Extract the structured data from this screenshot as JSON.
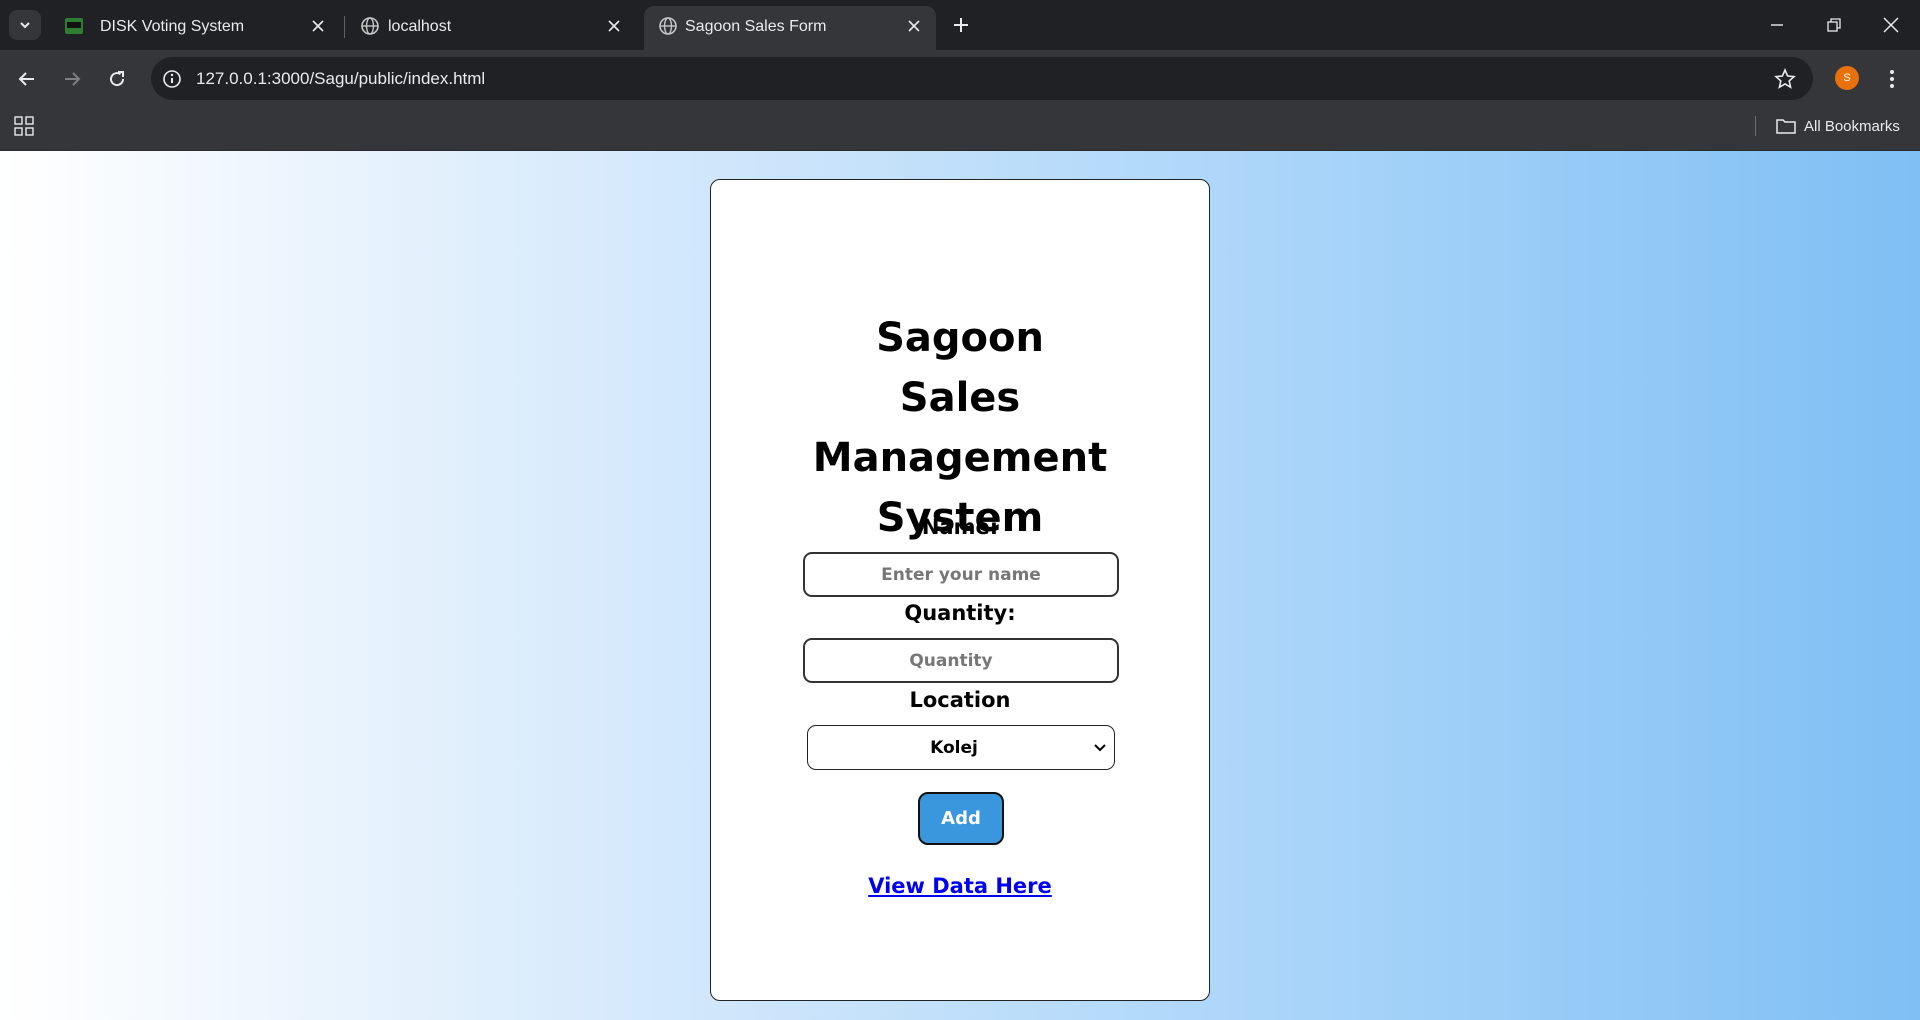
{
  "browser": {
    "tabs": [
      {
        "label": "DISK Voting System",
        "active": false
      },
      {
        "label": "localhost",
        "active": false
      },
      {
        "label": "Sagoon Sales Form",
        "active": true
      }
    ],
    "url": "127.0.0.1:3000/Sagu/public/index.html",
    "profile_initial": "S",
    "bookmarks_label": "All Bookmarks"
  },
  "form": {
    "title": "Sagoon Sales Management System",
    "name_label": "Name:",
    "name_placeholder": "Enter your name",
    "name_value": "",
    "quantity_label": "Quantity:",
    "quantity_placeholder": "Quantity",
    "quantity_value": "",
    "location_label": "Location",
    "location_selected": "Kolej",
    "add_label": "Add",
    "view_link": "View Data Here"
  },
  "colors": {
    "accent_button": "#3a96dd",
    "link": "#0000ee",
    "profile_avatar": "#e8710a"
  }
}
